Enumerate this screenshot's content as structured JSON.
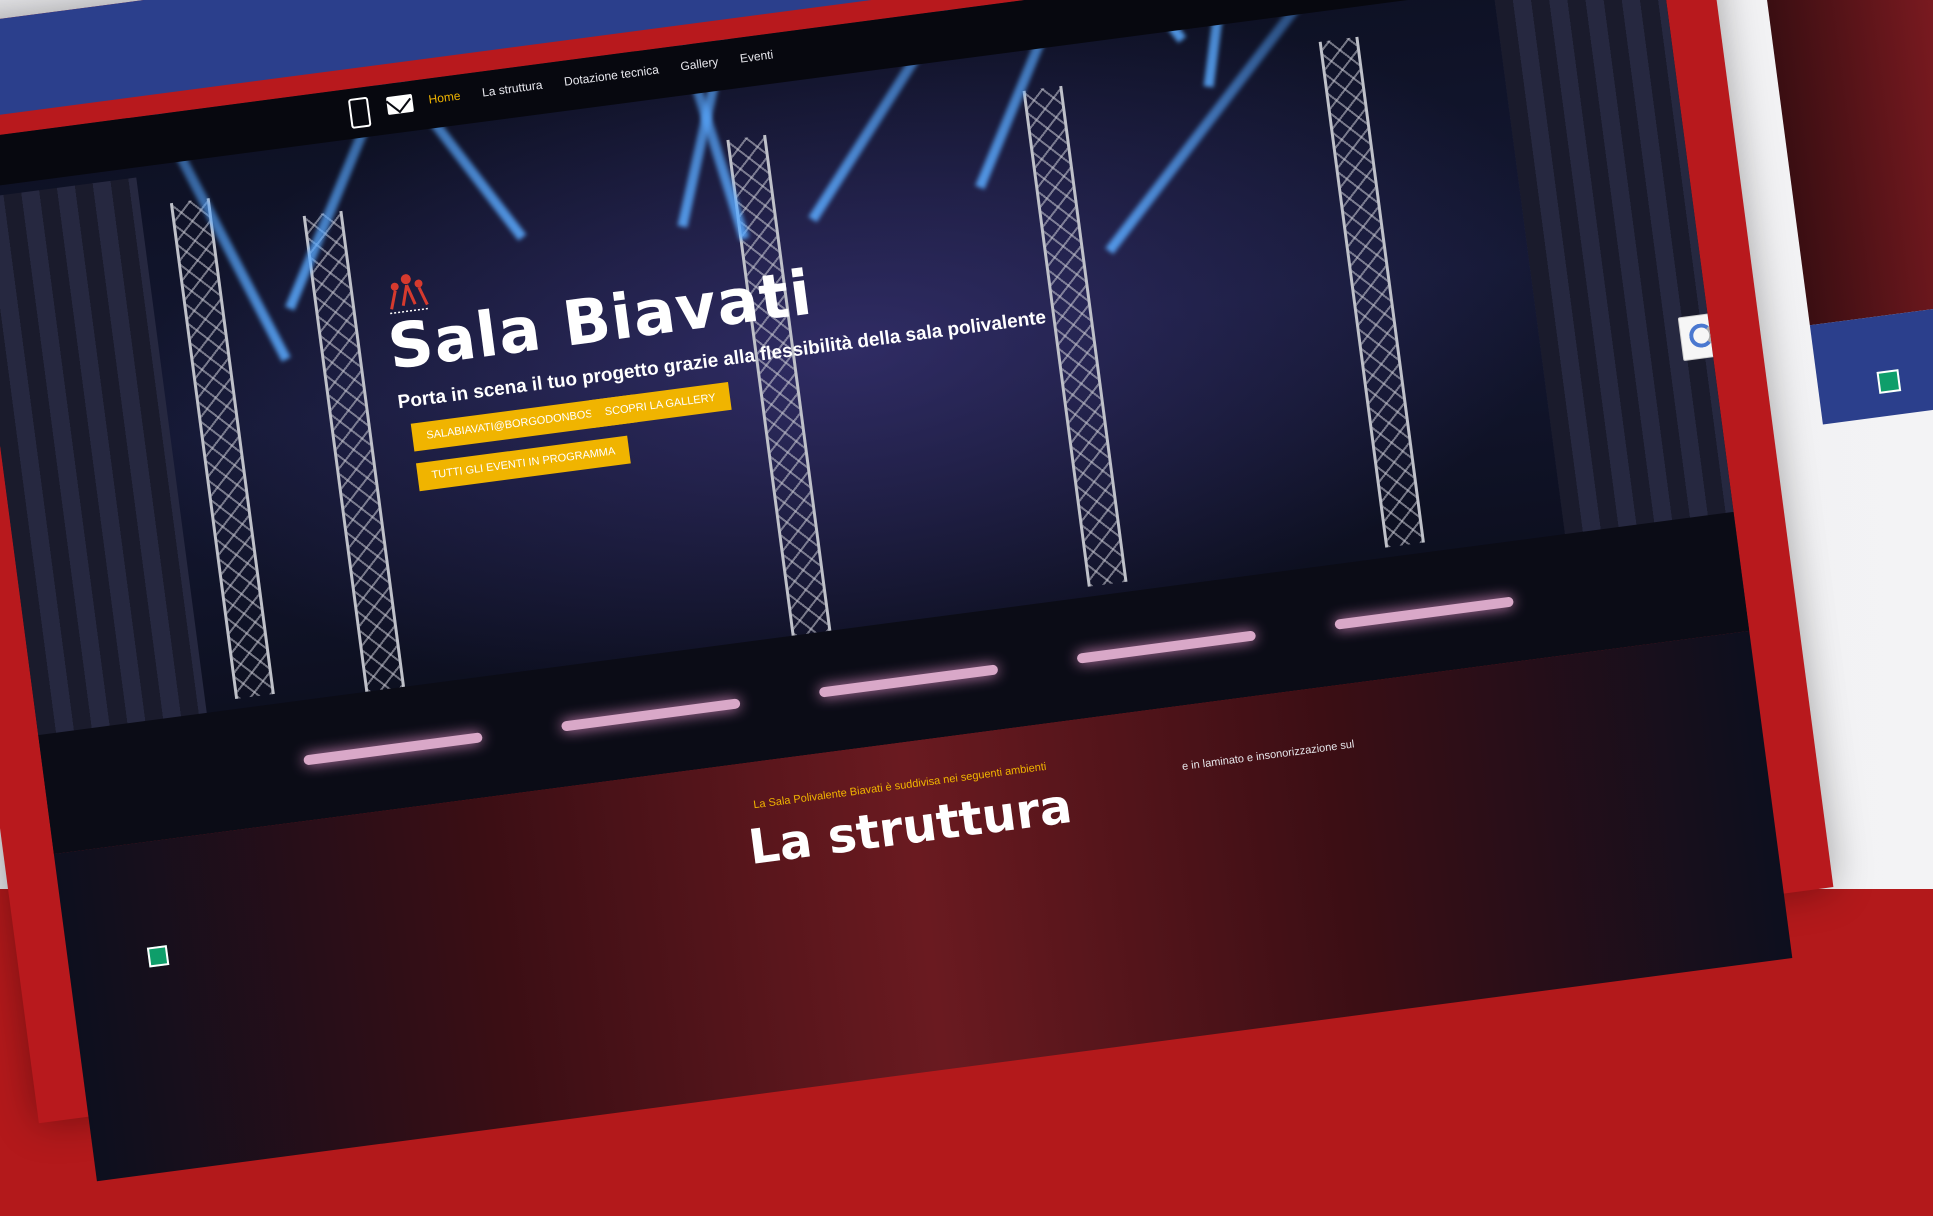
{
  "nav": {
    "items": [
      {
        "label": "Home",
        "active": true
      },
      {
        "label": "La struttura",
        "active": false
      },
      {
        "label": "Dotazione tecnica",
        "active": false
      },
      {
        "label": "Gallery",
        "active": false
      },
      {
        "label": "Eventi",
        "active": false
      }
    ]
  },
  "icons": {
    "phone": "phone-icon",
    "mail": "mail-icon",
    "logo": "sala-biavati-logo-icon",
    "recaptcha": "recaptcha-icon"
  },
  "hero": {
    "title": "Sala Biavati",
    "subtitle": "Porta in scena il tuo progetto grazie alla flessibilità della sala polivalente",
    "buttons": {
      "email": "SALABIAVATI@BORGODONBOSCO.IT",
      "gallery": "SCOPRI LA GALLERY",
      "events": "TUTTI GLI EVENTI IN PROGRAMMA"
    }
  },
  "structure": {
    "tagline": "La Sala Polivalente Biavati è suddivisa nei seguenti ambienti",
    "title": "La struttura",
    "text_fragment": "e in laminato e insonorizzazione sul"
  },
  "colors": {
    "frame_red": "#b8191d",
    "accent_yellow": "#f0b400",
    "strip_blue": "#2b3f8c",
    "hero_dark": "#0d1022"
  }
}
